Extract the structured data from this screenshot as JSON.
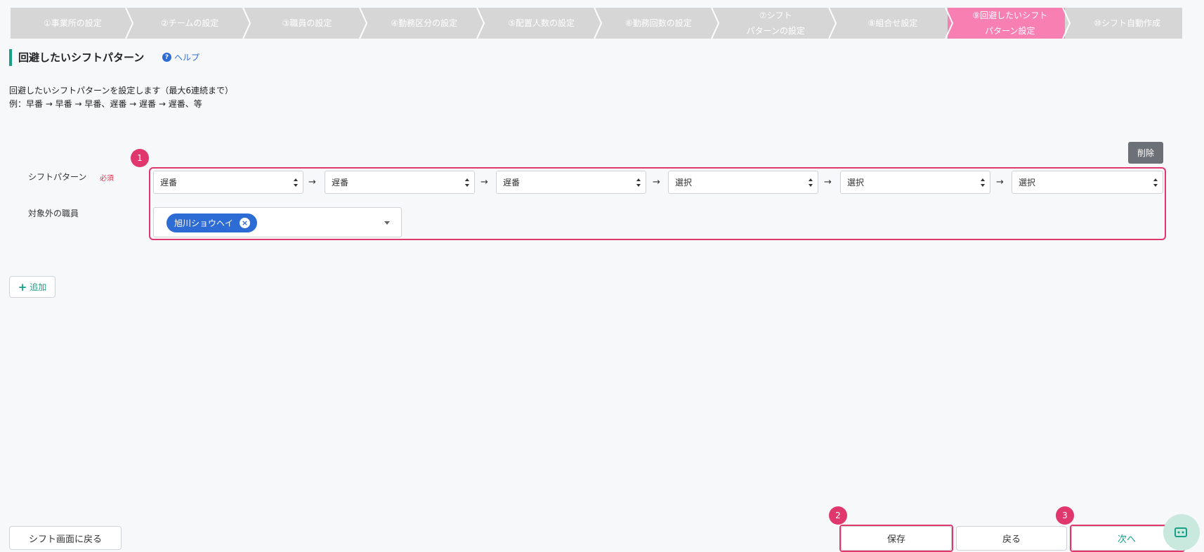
{
  "stepper": [
    {
      "label": "①事業所の設定",
      "active": false
    },
    {
      "label": "②チームの設定",
      "active": false
    },
    {
      "label": "③職員の設定",
      "active": false
    },
    {
      "label": "④勤務区分の設定",
      "active": false
    },
    {
      "label": "⑤配置人数の設定",
      "active": false
    },
    {
      "label": "⑥勤務回数の設定",
      "active": false
    },
    {
      "label": "⑦シフト\nパターンの設定",
      "active": false
    },
    {
      "label": "⑧組合せ設定",
      "active": false
    },
    {
      "label": "⑨回避したいシフト\nパターン設定",
      "active": true
    },
    {
      "label": "⑩シフト自動作成",
      "active": false
    }
  ],
  "page": {
    "title": "回避したいシフトパターン",
    "help_label": "ヘルプ",
    "description_line1": "回避したいシフトパターンを設定します（最大6連続まで）",
    "description_line2": "例：早番 → 早番 → 早番、遅番 → 遅番 → 遅番、等"
  },
  "form": {
    "delete_label": "削除",
    "pattern_label": "シフトパターン",
    "required_label": "必須",
    "excluded_label": "対象外の職員",
    "selects": [
      "遅番",
      "遅番",
      "遅番",
      "選択",
      "選択",
      "選択"
    ],
    "arrow": "→",
    "excluded_tags": [
      "旭川ショウヘイ"
    ],
    "add_label": "追加"
  },
  "footer": {
    "back_to_shift_label": "シフト画面に戻る",
    "save_label": "保存",
    "back_label": "戻る",
    "next_label": "次へ"
  },
  "annotations": {
    "badge1": "1",
    "badge2": "2",
    "badge3": "3",
    "color": "#e0376d"
  },
  "colors": {
    "step_inactive": "#d6d6d6",
    "step_active": "#f87fb1",
    "accent_green": "#16a085",
    "tag_blue": "#2d6bd5"
  }
}
